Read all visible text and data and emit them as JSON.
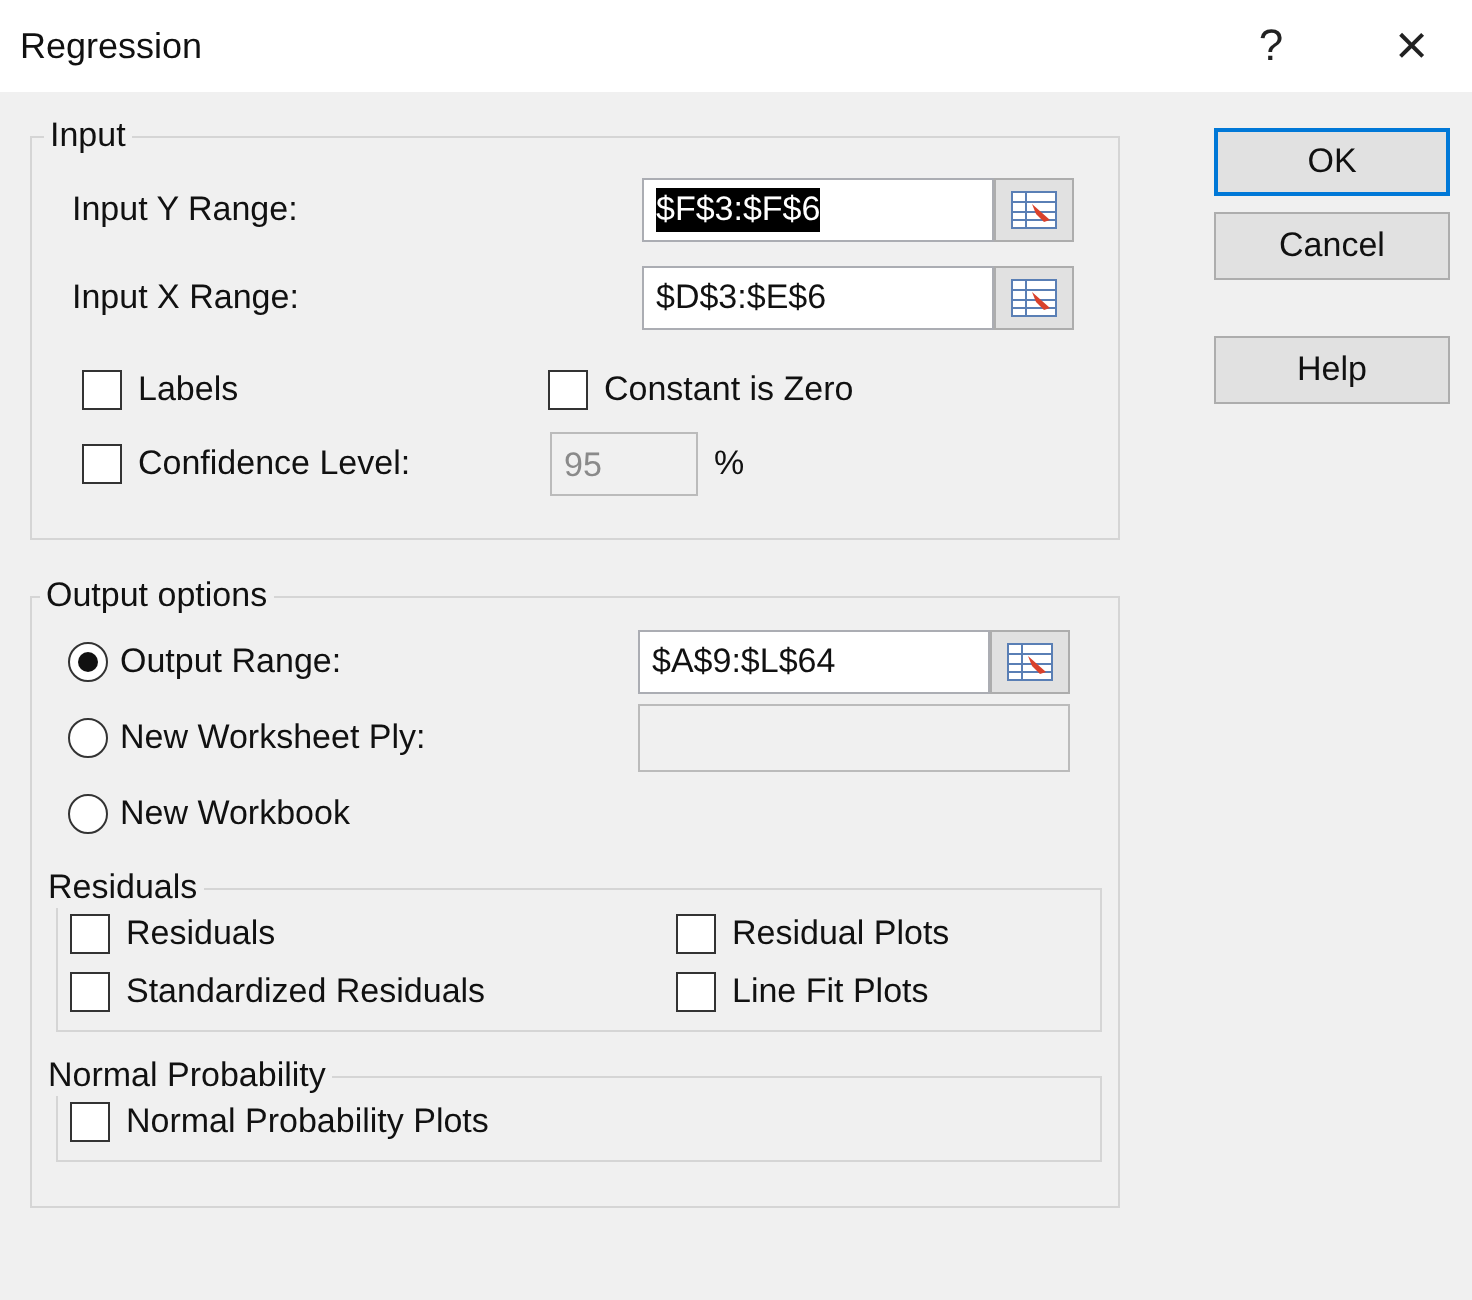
{
  "window": {
    "title": "Regression",
    "help_glyph": "?",
    "close_glyph": "×"
  },
  "input_group": {
    "legend": "Input",
    "ranges": [
      {
        "label": "Input Y Range:",
        "value": "$F$3:$F$6",
        "text_selected": true
      },
      {
        "label": "Input X Range:",
        "value": "$D$3:$E$6",
        "text_selected": false
      }
    ],
    "options": [
      {
        "label": "Labels",
        "checked": false
      },
      {
        "label": "Constant is Zero",
        "checked": false
      }
    ],
    "confidence": {
      "label": "Confidence Level:",
      "checked": false,
      "value": "95",
      "disabled": true,
      "unit": "%"
    }
  },
  "output_group": {
    "legend": "Output options",
    "destinations": [
      {
        "label": "Output Range:",
        "selected": true,
        "kind": "range",
        "value": "$A$9:$L$64"
      },
      {
        "label": "New Worksheet Ply:",
        "selected": false,
        "kind": "blank"
      },
      {
        "label": "New Workbook",
        "selected": false,
        "kind": "plain"
      }
    ],
    "residuals": {
      "legend": "Residuals",
      "options": [
        {
          "label": "Residuals",
          "checked": false
        },
        {
          "label": "Residual Plots",
          "checked": false
        },
        {
          "label": "Standardized Residuals",
          "checked": false
        },
        {
          "label": "Line Fit Plots",
          "checked": false
        }
      ]
    },
    "normal_probability": {
      "legend": "Normal Probability",
      "options": [
        {
          "label": "Normal Probability Plots",
          "checked": false
        }
      ]
    }
  },
  "buttons": [
    {
      "label": "OK",
      "default": true
    },
    {
      "label": "Cancel",
      "default": false
    },
    {
      "label": "Help",
      "default": false
    }
  ]
}
